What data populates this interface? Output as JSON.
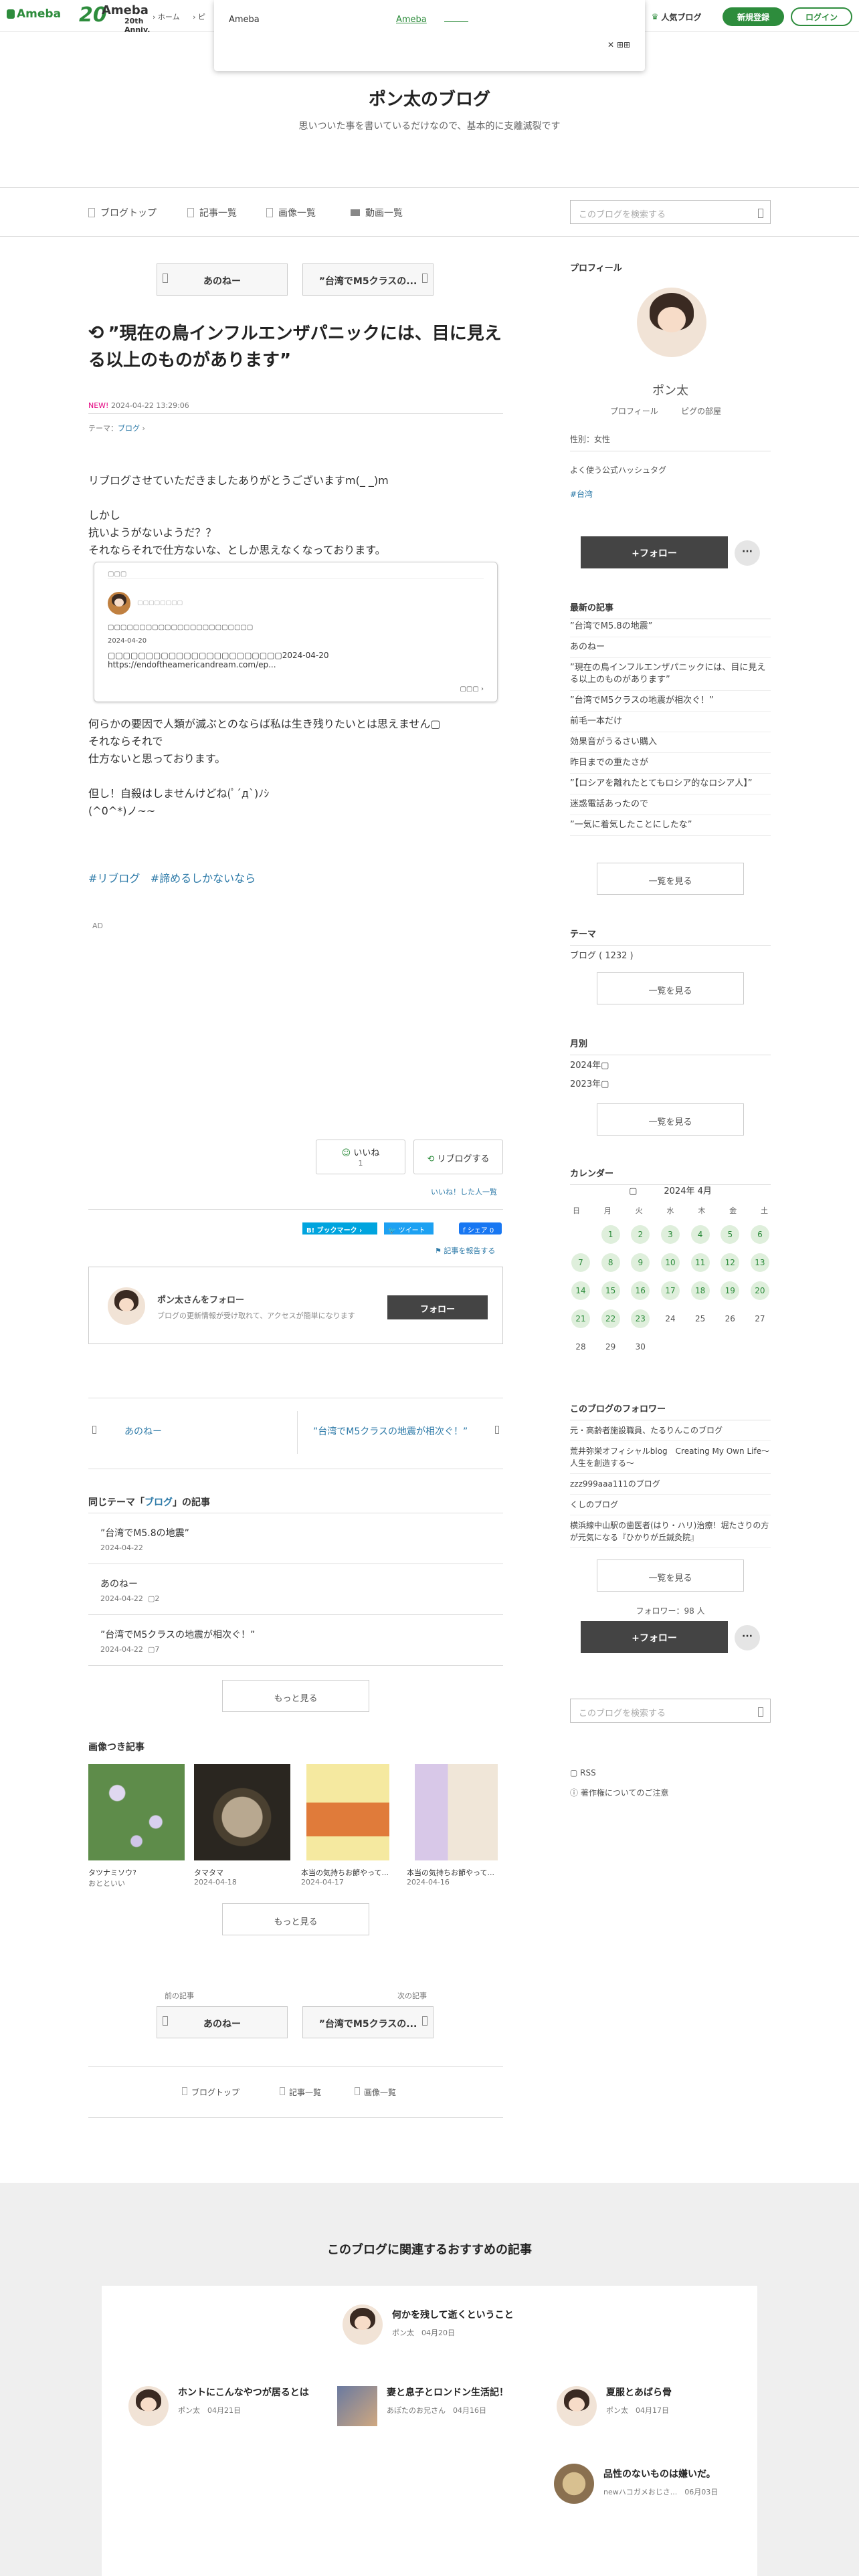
{
  "header": {
    "ameba_logo": "Ameba",
    "anniv_number": "20",
    "anniv_brand": "Ameba",
    "anniv_sub": "20th Anniv.",
    "breadcrumb": [
      "ホーム",
      "ピ"
    ],
    "popular_blogs": "人気ブログ",
    "register": "新規登録",
    "login": "ログイン"
  },
  "popup": {
    "title": "Ameba",
    "link_text": "Ameba",
    "close_label": "✕ ⊞⊞"
  },
  "blog": {
    "title": "ポン太のブログ",
    "description": "思いついた事を書いているだけなので、基本的に支離滅裂です"
  },
  "global_nav": {
    "items": [
      "ブログトップ",
      "記事一覧",
      "画像一覧",
      "動画一覧"
    ],
    "search_placeholder": "このブログを検索する"
  },
  "entry_nav_top": {
    "prev": "あのねー",
    "next": "”台湾でM5クラスの..."
  },
  "entry": {
    "title": "”現在の鳥インフルエンザパニックには、目に見える以上のものがあります”",
    "new_label": "NEW!",
    "datetime": "2024-04-22 13:29:06",
    "theme_prefix": "テーマ：",
    "theme": "ブログ",
    "body1": [
      "リブログさせていただきましたありがとうございますm(_ _)m",
      "",
      "しかし",
      "抗いようがないようだ？？",
      "それならそれで仕方ないな、としか思えなくなっております。"
    ],
    "embed": {
      "header": "▢▢▢",
      "author_name": "▢▢▢▢▢▢▢▢",
      "text_line": "▢▢▢▢▢▢▢▢▢▢▢▢▢▢▢▢▢▢▢▢▢▢▢",
      "date": "2024-04-20",
      "url_line": "▢▢▢▢▢▢▢▢▢▢▢▢▢▢▢▢▢▢▢▢▢▢▢2024-04-20 https://endoftheamericandream.com/ep...",
      "more": "▢▢▢ ›"
    },
    "body2": [
      "何らかの要因で人類が滅ぶとのならば私は生き残りたいとは思えません▢",
      "それならそれで",
      "仕方ないと思っております。",
      "",
      "但し！自殺はしませんけどね(ﾟ´д`)ﾉｼ",
      "(^0^*)ノ~~"
    ],
    "hashtags": [
      "#リブログ",
      "#諦めるしかないなら"
    ],
    "ad_label": "AD"
  },
  "actions": {
    "like": "いいね",
    "like_count": "1",
    "reblog": "リブログする",
    "like_users": "いいね！した人一覧",
    "hatena": "B! ブックマーク",
    "tweet": "ツイート",
    "fb_share": "シェア 0",
    "report": "記事を報告する"
  },
  "follow_card": {
    "title": "ポン太さんをフォロー",
    "desc": "ブログの更新情報が受け取れて、アクセスが簡単になります",
    "button": "フォロー"
  },
  "entry_nav_mid": {
    "prev": "あのねー",
    "next": "”台湾でM5クラスの地震が相次ぐ！”"
  },
  "same_theme": {
    "heading_pre": "同じテーマ「",
    "heading_theme": "ブログ",
    "heading_post": "」の記事",
    "items": [
      {
        "title": "”台湾でM5.8の地震”",
        "date": "2024-04-22",
        "comments": ""
      },
      {
        "title": "あのねー",
        "date": "2024-04-22",
        "comments": "2"
      },
      {
        "title": "”台湾でM5クラスの地震が相次ぐ！”",
        "date": "2024-04-22",
        "comments": "7"
      }
    ],
    "more": "もっと見る"
  },
  "image_articles": {
    "heading": "画像つき記事",
    "items": [
      {
        "title": "タツナミソウ?",
        "date": "おとといい"
      },
      {
        "title": "タマタマ",
        "date": "2024-04-18"
      },
      {
        "title": "本当の気持ちお節やって...",
        "date": "2024-04-17"
      },
      {
        "title": "本当の気持ちお節やって...",
        "date": "2024-04-16"
      }
    ],
    "more": "もっと見る"
  },
  "entry_nav_bottom": {
    "prev_label": "前の記事",
    "next_label": "次の記事",
    "prev": "あのねー",
    "next": "”台湾でM5クラスの..."
  },
  "bottom_nav": [
    "ブログトップ",
    "記事一覧",
    "画像一覧"
  ],
  "sidebar": {
    "profile_heading": "プロフィール",
    "profile_name": "ポン太",
    "profile_link": "プロフィール",
    "pigg_link": "ピグの部屋",
    "gender": "性別：女性",
    "hashtags_heading": "よく使う公式ハッシュタグ",
    "hashtag": "#台湾",
    "follow": "+フォロー",
    "dots": "···",
    "recent_heading": "最新の記事",
    "recent": [
      "”台湾でM5.8の地震”",
      "あのねー",
      "”現在の鳥インフルエンザパニックには、目に見える以上のものがあります”",
      "”台湾でM5クラスの地震が相次ぐ！”",
      "前毛一本だけ",
      "効果音がうるさい購入",
      "昨日までの重たさが",
      "”【ロシアを離れたとてもロシア的なロシア人】”",
      "迷惑電話あったので",
      "”一気に着気したことにしたな”"
    ],
    "see_all": "一覧を見る",
    "theme_heading": "テーマ",
    "theme_item": "ブログ ( 1232 )",
    "month_heading": "月別",
    "months": [
      "2024年▢",
      "2023年▢"
    ],
    "calendar_heading": "カレンダー",
    "calendar_month": "2024年 4月",
    "weekdays": [
      "日",
      "月",
      "火",
      "水",
      "木",
      "金",
      "土"
    ],
    "weeks": [
      [
        "",
        "1",
        "2",
        "3",
        "4",
        "5",
        "6"
      ],
      [
        "7",
        "8",
        "9",
        "10",
        "11",
        "12",
        "13"
      ],
      [
        "14",
        "15",
        "16",
        "17",
        "18",
        "19",
        "20"
      ],
      [
        "21",
        "22",
        "23",
        "24",
        "25",
        "26",
        "27"
      ],
      [
        "28",
        "29",
        "30",
        "",
        "",
        "",
        ""
      ]
    ],
    "posted_days": [
      "1",
      "2",
      "3",
      "4",
      "5",
      "6",
      "7",
      "8",
      "9",
      "10",
      "11",
      "12",
      "13",
      "14",
      "15",
      "16",
      "17",
      "18",
      "19",
      "20",
      "21",
      "22",
      "23"
    ],
    "followees_heading": "このブログのフォロワー",
    "followees": [
      "元・高齢者施設職員、たるりんこのブログ",
      "荒井弥栄オフィシャルblog　Creating My Own Life〜人生を創造する〜",
      "zzz999aaa111のブログ",
      "くしのブログ",
      "横浜線中山駅の歯医者(はり・ハリ)治療！堀たさりの方が元気になる『ひかりが丘鍼灸院』"
    ],
    "follower_count": "フォロワー：98 人",
    "search_placeholder": "このブログを検索する",
    "rss": "RSS",
    "copyright": "著作権についてのご注意"
  },
  "recommend": {
    "heading": "このブログに関連するおすすめの記事",
    "items": [
      {
        "title": "何かを残して逝くということ",
        "author": "ポン太",
        "date": "04月20日"
      },
      {
        "title": "ホントにこんなやつが居るとは",
        "author": "ポン太",
        "date": "04月21日"
      },
      {
        "title": "妻と息子とロンドン生活記！",
        "author": "あぽたのお兄さん",
        "date": "04月16日"
      },
      {
        "title": "夏服とあばら骨",
        "author": "ポン太",
        "date": "04月17日"
      },
      {
        "title": "品性のないものは嫌いだ。",
        "author": "newハコガメおじさ...",
        "date": "06月03日"
      }
    ]
  },
  "colors": {
    "brand_green": "#2d8c3c",
    "link_blue": "#2d7aa8",
    "new_pink": "#e4007f"
  }
}
